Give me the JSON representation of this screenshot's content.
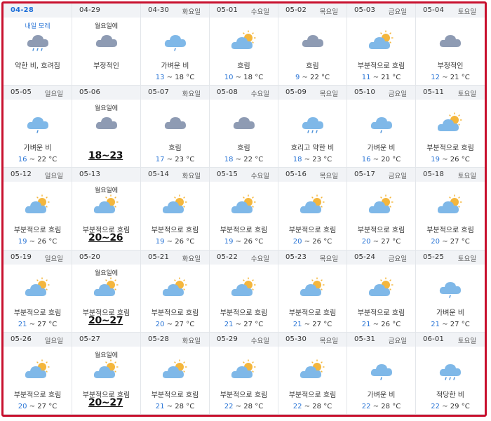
{
  "colors": {
    "frame": "#c8102e",
    "header_bg": "#f1f3f6",
    "low_temp": "#2a75d6",
    "date_blue": "#1e6fd9",
    "cloud_gray": "#8e9bb3",
    "cloud_blue": "#7fb8e8",
    "sun": "#f4b63c",
    "rain": "#4a90d9"
  },
  "days": [
    {
      "date": "04-28",
      "weekday": "",
      "sub": "내일 모레",
      "icon": "rain-gray-icon",
      "condition": "약한 비, 흐려짐",
      "low": "",
      "high": "",
      "sep": "",
      "unit": "",
      "big": ""
    },
    {
      "date": "04-29",
      "weekday": "",
      "sub": "월요일에",
      "icon": "cloud-gray-icon",
      "condition": "부정적인",
      "low": "",
      "high": "",
      "sep": "",
      "unit": "",
      "big": ""
    },
    {
      "date": "04-30",
      "weekday": "화요일",
      "sub": "",
      "icon": "cloud-blue-drizzle-icon",
      "condition": "가벼운 비",
      "low": "13",
      "high": "18",
      "sep": " ~ ",
      "unit": " °C",
      "big": ""
    },
    {
      "date": "05-01",
      "weekday": "수요일",
      "sub": "",
      "icon": "partly-sunny-icon",
      "condition": "흐림",
      "low": "10",
      "high": "18",
      "sep": " ~ ",
      "unit": " °C",
      "big": ""
    },
    {
      "date": "05-02",
      "weekday": "목요일",
      "sub": "",
      "icon": "cloud-gray-icon",
      "condition": "흐림",
      "low": "9",
      "high": "22",
      "sep": " ~ ",
      "unit": " °C",
      "big": ""
    },
    {
      "date": "05-03",
      "weekday": "금요일",
      "sub": "",
      "icon": "partly-sunny-icon",
      "condition": "부분적으로 흐림",
      "low": "11",
      "high": "21",
      "sep": " ~ ",
      "unit": " °C",
      "big": ""
    },
    {
      "date": "05-04",
      "weekday": "토요일",
      "sub": "",
      "icon": "cloud-gray-icon",
      "condition": "부정적인",
      "low": "12",
      "high": "21",
      "sep": " ~ ",
      "unit": " °C",
      "big": ""
    },
    {
      "date": "05-05",
      "weekday": "일요일",
      "sub": "",
      "icon": "cloud-blue-drizzle-icon",
      "condition": "가벼운 비",
      "low": "16",
      "high": "22",
      "sep": " ~ ",
      "unit": " °C",
      "big": ""
    },
    {
      "date": "05-06",
      "weekday": "",
      "sub": "월요일에",
      "icon": "cloud-gray-icon",
      "condition": "",
      "low": "",
      "high": "",
      "sep": "",
      "unit": "",
      "big": "18~23"
    },
    {
      "date": "05-07",
      "weekday": "화요일",
      "sub": "",
      "icon": "cloud-gray-icon",
      "condition": "흐림",
      "low": "17",
      "high": "23",
      "sep": " ~ ",
      "unit": " °C",
      "big": ""
    },
    {
      "date": "05-08",
      "weekday": "수요일",
      "sub": "",
      "icon": "cloud-gray-icon",
      "condition": "흐림",
      "low": "18",
      "high": "22",
      "sep": " ~ ",
      "unit": " °C",
      "big": ""
    },
    {
      "date": "05-09",
      "weekday": "목요일",
      "sub": "",
      "icon": "rain-blue-icon",
      "condition": "흐리고 약한 비",
      "low": "18",
      "high": "23",
      "sep": " ~ ",
      "unit": " °C",
      "big": ""
    },
    {
      "date": "05-10",
      "weekday": "금요일",
      "sub": "",
      "icon": "cloud-blue-drizzle-icon",
      "condition": "가벼운 비",
      "low": "16",
      "high": "20",
      "sep": " ~ ",
      "unit": " °C",
      "big": ""
    },
    {
      "date": "05-11",
      "weekday": "토요일",
      "sub": "",
      "icon": "partly-sunny-icon",
      "condition": "부분적으로 흐림",
      "low": "19",
      "high": "26",
      "sep": " ~ ",
      "unit": " °C",
      "big": ""
    },
    {
      "date": "05-12",
      "weekday": "일요일",
      "sub": "",
      "icon": "partly-sunny-icon",
      "condition": "부분적으로 흐림",
      "low": "19",
      "high": "26",
      "sep": " ~ ",
      "unit": " °C",
      "big": ""
    },
    {
      "date": "05-13",
      "weekday": "",
      "sub": "월요일에",
      "icon": "partly-sunny-icon",
      "condition": "부분적으로 흐림",
      "low": "",
      "high": "",
      "sep": "",
      "unit": "",
      "big": "20~26"
    },
    {
      "date": "05-14",
      "weekday": "화요일",
      "sub": "",
      "icon": "partly-sunny-icon",
      "condition": "부분적으로 흐림",
      "low": "19",
      "high": "26",
      "sep": " ~ ",
      "unit": " °C",
      "big": ""
    },
    {
      "date": "05-15",
      "weekday": "수요일",
      "sub": "",
      "icon": "partly-sunny-icon",
      "condition": "부분적으로 흐림",
      "low": "19",
      "high": "26",
      "sep": " ~ ",
      "unit": " °C",
      "big": ""
    },
    {
      "date": "05-16",
      "weekday": "목요일",
      "sub": "",
      "icon": "partly-sunny-icon",
      "condition": "부분적으로 흐림",
      "low": "20",
      "high": "26",
      "sep": " ~ ",
      "unit": " °C",
      "big": ""
    },
    {
      "date": "05-17",
      "weekday": "금요일",
      "sub": "",
      "icon": "partly-sunny-icon",
      "condition": "부분적으로 흐림",
      "low": "20",
      "high": "27",
      "sep": " ~ ",
      "unit": " °C",
      "big": ""
    },
    {
      "date": "05-18",
      "weekday": "토요일",
      "sub": "",
      "icon": "partly-sunny-icon",
      "condition": "부분적으로 흐림",
      "low": "20",
      "high": "27",
      "sep": " ~ ",
      "unit": " °C",
      "big": ""
    },
    {
      "date": "05-19",
      "weekday": "일요일",
      "sub": "",
      "icon": "partly-sunny-icon",
      "condition": "부분적으로 흐림",
      "low": "21",
      "high": "27",
      "sep": " ~ ",
      "unit": " °C",
      "big": ""
    },
    {
      "date": "05-20",
      "weekday": "",
      "sub": "월요일에",
      "icon": "partly-sunny-icon",
      "condition": "부분적으로 흐림",
      "low": "",
      "high": "",
      "sep": "",
      "unit": "",
      "big": "20~27"
    },
    {
      "date": "05-21",
      "weekday": "화요일",
      "sub": "",
      "icon": "partly-sunny-icon",
      "condition": "부분적으로 흐림",
      "low": "20",
      "high": "27",
      "sep": " ~ ",
      "unit": " °C",
      "big": ""
    },
    {
      "date": "05-22",
      "weekday": "수요일",
      "sub": "",
      "icon": "partly-sunny-icon",
      "condition": "부분적으로 흐림",
      "low": "21",
      "high": "27",
      "sep": " ~ ",
      "unit": " °C",
      "big": ""
    },
    {
      "date": "05-23",
      "weekday": "목요일",
      "sub": "",
      "icon": "partly-sunny-icon",
      "condition": "부분적으로 흐림",
      "low": "21",
      "high": "27",
      "sep": " ~ ",
      "unit": " °C",
      "big": ""
    },
    {
      "date": "05-24",
      "weekday": "금요일",
      "sub": "",
      "icon": "partly-sunny-icon",
      "condition": "부분적으로 흐림",
      "low": "21",
      "high": "26",
      "sep": " ~ ",
      "unit": " °C",
      "big": ""
    },
    {
      "date": "05-25",
      "weekday": "토요일",
      "sub": "",
      "icon": "cloud-blue-drizzle-icon",
      "condition": "가벼운 비",
      "low": "21",
      "high": "27",
      "sep": " ~ ",
      "unit": " °C",
      "big": ""
    },
    {
      "date": "05-26",
      "weekday": "일요일",
      "sub": "",
      "icon": "partly-sunny-icon",
      "condition": "부분적으로 흐림",
      "low": "20",
      "high": "27",
      "sep": " ~ ",
      "unit": " °C",
      "big": ""
    },
    {
      "date": "05-27",
      "weekday": "",
      "sub": "월요일에",
      "icon": "partly-sunny-icon",
      "condition": "부분적으로 흐림",
      "low": "",
      "high": "",
      "sep": "",
      "unit": "",
      "big": "20~27"
    },
    {
      "date": "05-28",
      "weekday": "화요일",
      "sub": "",
      "icon": "partly-sunny-icon",
      "condition": "부분적으로 흐림",
      "low": "21",
      "high": "28",
      "sep": " ~ ",
      "unit": " °C",
      "big": ""
    },
    {
      "date": "05-29",
      "weekday": "수요일",
      "sub": "",
      "icon": "partly-sunny-icon",
      "condition": "부분적으로 흐림",
      "low": "22",
      "high": "28",
      "sep": " ~ ",
      "unit": " °C",
      "big": ""
    },
    {
      "date": "05-30",
      "weekday": "목요일",
      "sub": "",
      "icon": "partly-sunny-icon",
      "condition": "부분적으로 흐림",
      "low": "22",
      "high": "28",
      "sep": " ~ ",
      "unit": " °C",
      "big": ""
    },
    {
      "date": "05-31",
      "weekday": "금요일",
      "sub": "",
      "icon": "cloud-blue-drizzle-icon",
      "condition": "가벼운 비",
      "low": "22",
      "high": "28",
      "sep": " ~ ",
      "unit": " °C",
      "big": ""
    },
    {
      "date": "06-01",
      "weekday": "토요일",
      "sub": "",
      "icon": "rain-blue-icon",
      "condition": "적당한 비",
      "low": "22",
      "high": "29",
      "sep": " ~ ",
      "unit": " °C",
      "big": ""
    }
  ]
}
